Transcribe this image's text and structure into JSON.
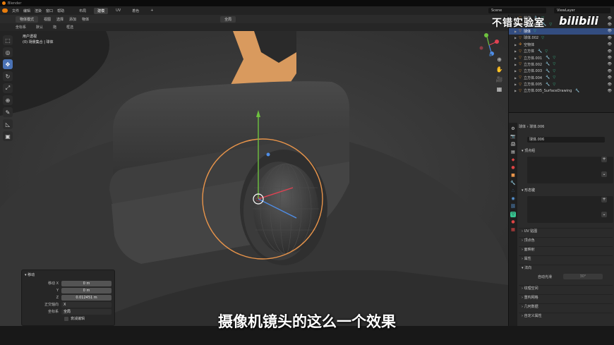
{
  "app": {
    "title": "Blender"
  },
  "menubar": {
    "items": [
      "文件",
      "编辑",
      "渲染",
      "窗口",
      "帮助"
    ],
    "workspace_tabs": [
      "布局",
      "建模",
      "UV",
      "着色"
    ],
    "active_tab_index": 1,
    "scene": "Scene",
    "view_layer": "ViewLayer"
  },
  "tool_header": {
    "mode": "物体模式",
    "menus": [
      "视图",
      "选择",
      "添加",
      "物体"
    ],
    "transform_orientation": "全局"
  },
  "options_header": {
    "items": [
      "坐标系",
      "默认",
      "拖",
      "框选"
    ]
  },
  "viewport": {
    "view_name": "用户透视",
    "collection_object": "(0) 场景集合 | 球体"
  },
  "toolbar": {
    "tools": [
      {
        "icon": "cursor-select-icon",
        "glyph": "⬚"
      },
      {
        "icon": "cursor-icon",
        "glyph": "◎"
      },
      {
        "icon": "move-icon",
        "glyph": "✥"
      },
      {
        "icon": "rotate-icon",
        "glyph": "↻"
      },
      {
        "icon": "scale-icon",
        "glyph": "⤢"
      },
      {
        "icon": "transform-icon",
        "glyph": "⊕"
      },
      {
        "icon": "annotate-icon",
        "glyph": "✎"
      },
      {
        "icon": "measure-icon",
        "glyph": "📐"
      },
      {
        "icon": "add-cube-icon",
        "glyph": "▣"
      }
    ],
    "active_index": 2
  },
  "operator_panel": {
    "title": "移动",
    "rows": [
      {
        "label": "移动 X",
        "value": "0 m"
      },
      {
        "label": "Y",
        "value": "0 m"
      },
      {
        "label": "Z",
        "value": "0.012451 m"
      }
    ],
    "orient_axis": {
      "label": "正交轴向",
      "value": "X"
    },
    "orientation": {
      "label": "坐标系",
      "value": "全局"
    },
    "proportional": {
      "label": "衰减编辑"
    }
  },
  "subtitle": "摄像机镜头的这么一个效果",
  "watermark": {
    "text": "不错实验室",
    "logo": "bilibili"
  },
  "outliner": {
    "items": [
      {
        "name": "柱体",
        "selected": false
      },
      {
        "name": "柱体.001",
        "selected": false
      },
      {
        "name": "球体",
        "selected": true
      },
      {
        "name": "球体.002",
        "selected": false
      },
      {
        "name": "空物体",
        "selected": false
      },
      {
        "name": "立方体",
        "selected": false
      },
      {
        "name": "立方体.001",
        "selected": false
      },
      {
        "name": "立方体.002",
        "selected": false
      },
      {
        "name": "立方体.003",
        "selected": false
      },
      {
        "name": "立方体.004",
        "selected": false
      },
      {
        "name": "立方体.005",
        "selected": false
      },
      {
        "name": "立方体.005_SurfaceDrawing",
        "selected": false
      }
    ]
  },
  "properties": {
    "breadcrumb_obj": "球体",
    "breadcrumb_data": "球体.006",
    "mesh_name": "球体.006",
    "vertex_groups": "顶点组",
    "shape_keys": "形态键",
    "collapsed": [
      "UV 贴图",
      "顶点色",
      "面映射",
      "属性",
      "法向"
    ],
    "auto_smooth_label": "自动光滑",
    "auto_smooth_value": "30°",
    "collapsed_more": [
      "纹理空间",
      "重构网格",
      "几何数据",
      "自定义属性"
    ]
  }
}
